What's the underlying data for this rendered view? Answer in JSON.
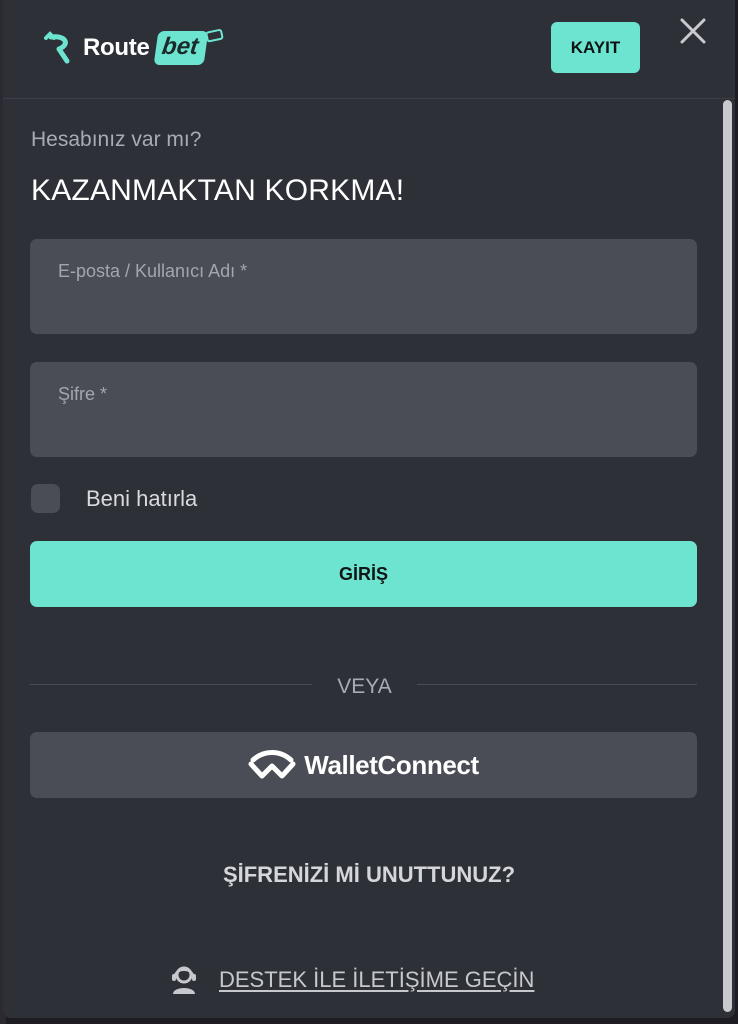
{
  "header": {
    "logo_route": "Route",
    "logo_bet": "bet",
    "register_label": "KAYIT"
  },
  "form": {
    "subtitle": "Hesabınız var mı?",
    "headline": "KAZANMAKTAN KORKMA!",
    "email_placeholder": "E-posta / Kullanıcı Adı *",
    "password_placeholder": "Şifre *",
    "remember_label": "Beni hatırla",
    "login_label": "GİRİŞ",
    "divider_text": "VEYA",
    "walletconnect_label": "WalletConnect",
    "forgot_label": "ŞİFRENİZİ Mİ UNUTTUNUZ?",
    "support_label": "DESTEK İLE İLETİŞİME GEÇİN"
  },
  "colors": {
    "accent": "#6de4d0",
    "modal_bg": "#2e3038",
    "field_bg": "#4b4d56"
  },
  "icons": [
    "route-logo-icon",
    "tag-icon",
    "close-icon",
    "walletconnect-icon",
    "support-agent-icon"
  ]
}
